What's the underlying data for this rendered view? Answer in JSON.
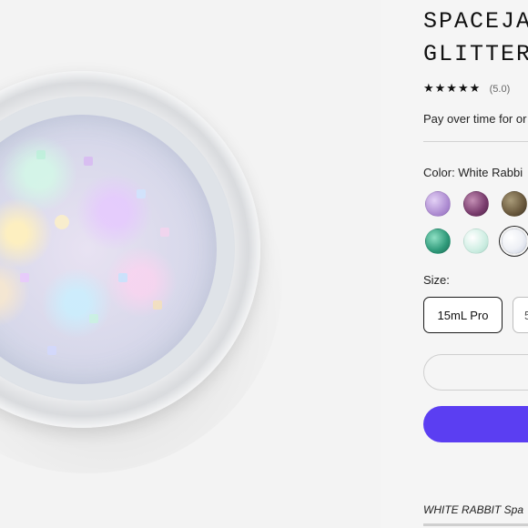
{
  "product": {
    "title_line1": "SPACEJAM",
    "title_line2": "GLITTER",
    "stars": "★★★★★",
    "rating": "(5.0)",
    "pay_note": "Pay over time for or",
    "color_label": "Color: White Rabbi",
    "swatches": [
      {
        "name": "lavender-glitter",
        "color": "#b08fd3"
      },
      {
        "name": "purple-glitter",
        "color": "#7a3d6e"
      },
      {
        "name": "olive-glitter",
        "color": "#6b5a3e"
      },
      {
        "name": "teal-glitter",
        "color": "#2f9a7a"
      },
      {
        "name": "mint-glitter",
        "color": "#cfeee3"
      },
      {
        "name": "white-rabbit-glitter",
        "color": "#eef0f5",
        "selected": true
      }
    ],
    "size_label": "Size:",
    "sizes": [
      "15mL Pro",
      "5"
    ],
    "description_snippet": "WHITE RABBIT Spa"
  },
  "colors": {
    "accent": "#5b3ef2",
    "background": "#f5f5f5"
  }
}
